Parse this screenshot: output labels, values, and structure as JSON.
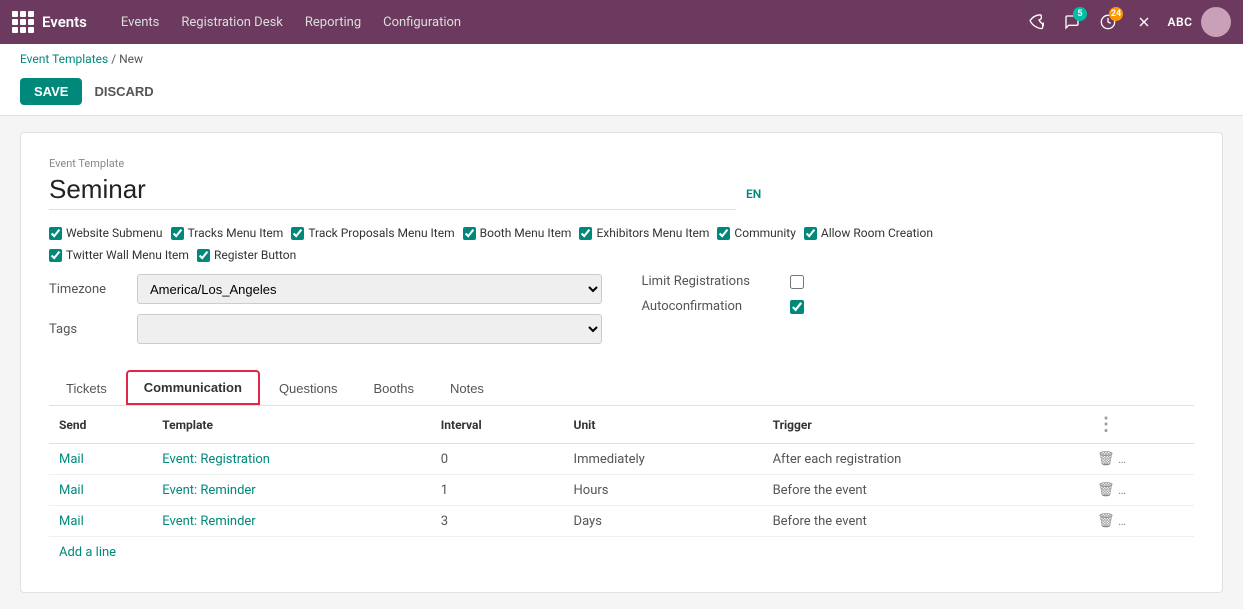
{
  "topbar": {
    "brand": "Events",
    "nav": [
      "Events",
      "Registration Desk",
      "Reporting",
      "Configuration"
    ],
    "user_initials": "ABC",
    "badge_chat": "5",
    "badge_clock": "24"
  },
  "breadcrumb": {
    "parent": "Event Templates",
    "current": "New"
  },
  "buttons": {
    "save": "SAVE",
    "discard": "DISCARD"
  },
  "form": {
    "label": "Event Template",
    "title": "Seminar",
    "lang": "EN",
    "checkboxes": [
      {
        "label": "Website Submenu",
        "checked": true
      },
      {
        "label": "Tracks Menu Item",
        "checked": true
      },
      {
        "label": "Track Proposals Menu Item",
        "checked": true
      },
      {
        "label": "Booth Menu Item",
        "checked": true
      },
      {
        "label": "Exhibitors Menu Item",
        "checked": true
      },
      {
        "label": "Community",
        "checked": true
      },
      {
        "label": "Allow Room Creation",
        "checked": true
      },
      {
        "label": "Twitter Wall Menu Item",
        "checked": true
      },
      {
        "label": "Register Button",
        "checked": true
      }
    ],
    "timezone_label": "Timezone",
    "timezone_value": "America/Los_Angeles",
    "tags_label": "Tags",
    "limit_registrations_label": "Limit Registrations",
    "limit_registrations_checked": false,
    "autoconfirmation_label": "Autoconfirmation",
    "autoconfirmation_checked": true
  },
  "tabs": [
    {
      "label": "Tickets",
      "active": false
    },
    {
      "label": "Communication",
      "active": true
    },
    {
      "label": "Questions",
      "active": false
    },
    {
      "label": "Booths",
      "active": false
    },
    {
      "label": "Notes",
      "active": false
    }
  ],
  "table": {
    "columns": [
      "Send",
      "Template",
      "Interval",
      "Unit",
      "Trigger"
    ],
    "rows": [
      {
        "send": "Mail",
        "template": "Event: Registration",
        "interval": "0",
        "unit": "Immediately",
        "trigger": "After each registration"
      },
      {
        "send": "Mail",
        "template": "Event: Reminder",
        "interval": "1",
        "unit": "Hours",
        "trigger": "Before the event"
      },
      {
        "send": "Mail",
        "template": "Event: Reminder",
        "interval": "3",
        "unit": "Days",
        "trigger": "Before the event"
      }
    ],
    "add_line": "Add a line"
  }
}
